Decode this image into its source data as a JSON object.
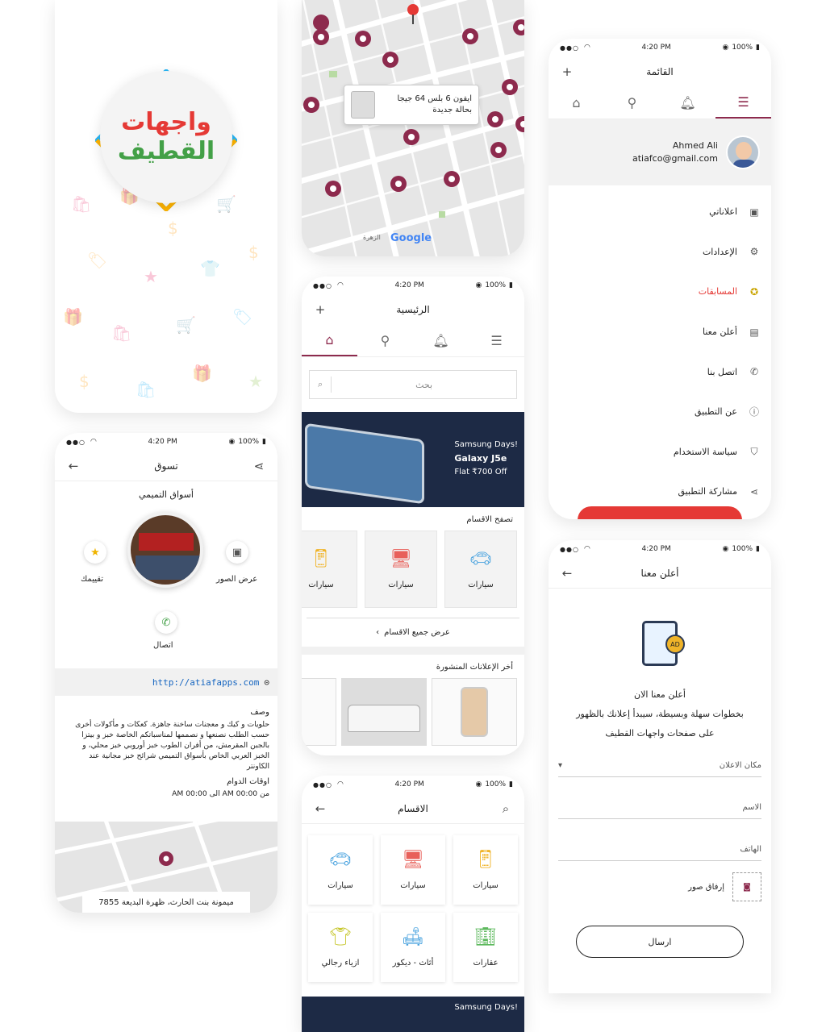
{
  "status": {
    "time": "4:20 PM",
    "battery": "100%"
  },
  "splash": {
    "logo_line1": "واجهات",
    "logo_line2": "القطيف"
  },
  "map_top": {
    "callout_line1": "ايفون 6 بلس 64 جيجا",
    "callout_line2": "بحالة جديدة",
    "google": "Google",
    "area_label": "الزهرة"
  },
  "menu": {
    "title": "القائمة",
    "profile_name": "Ahmed Ali",
    "profile_email": "atiafco@gmail.com",
    "items": [
      {
        "label": "اعلاناتي",
        "icon": "calendar-icon"
      },
      {
        "label": "الإعدادات",
        "icon": "gear-icon"
      },
      {
        "label": "المسابقات",
        "icon": "award-icon"
      },
      {
        "label": "أعلن معنا",
        "icon": "ad-icon"
      },
      {
        "label": "اتصل بنا",
        "icon": "phone-icon"
      },
      {
        "label": "عن التطبيق",
        "icon": "info-icon"
      },
      {
        "label": "سياسة الاستخدام",
        "icon": "shield-icon"
      },
      {
        "label": "مشاركة التطبيق",
        "icon": "share-icon"
      }
    ],
    "accent": "#e53935"
  },
  "home": {
    "title": "الرئيسية",
    "search_placeholder": "بحث",
    "banner_line1": "Samsung Days!",
    "banner_line2": "Galaxy J5e",
    "banner_line3": "Flat ₹700 Off",
    "browse_title": "تصفح الاقسام",
    "categories": [
      "سيارات",
      "سيارات",
      "سيارات"
    ],
    "view_all": "عرض جميع الاقسام",
    "latest_ads_title": "أخر الإعلانات المنشورة"
  },
  "shop": {
    "title": "تسوق",
    "store_name": "أسواق التميمي",
    "rate_label": "تقييمك",
    "gallery_label": "عرض الصور",
    "call_label": "اتصال",
    "link": "http://atiafapps.com",
    "desc_title": "وصف",
    "desc_text": "حلويات و كيك و معجنات ساخنة جاهزة. كعكات و مأكولات أخرى حسب الطلب نصنعها و نصممها لمناسباتكم الخاصة خبز و بيتزا بالجبن المقرمش، من أفران الطوب خبز أوروبي خبز محلي، و الخبز العربي الخاص بأسواق التميمي شرائح خبز مجانية عند الكاونتر",
    "hours_title": "اوقات الدوام",
    "hours_text": "من AM 00:00 الى AM 00:00",
    "address": "ميمونة بنت الحارث، ظهرة البديعة 7855"
  },
  "cats_page": {
    "title": "الاقسام",
    "items": [
      {
        "label": "سيارات",
        "icon": "car-icon",
        "color": "#4aa3df"
      },
      {
        "label": "سيارات",
        "icon": "monitor-icon",
        "color": "#e8605a"
      },
      {
        "label": "سيارات",
        "icon": "phone-icon",
        "color": "#f0b429"
      },
      {
        "label": "ازياء رجالي",
        "icon": "shirt-icon",
        "color": "#c8c832"
      },
      {
        "label": "أثاث - ديكور",
        "icon": "sofa-icon",
        "color": "#4aa3df"
      },
      {
        "label": "عقارات",
        "icon": "building-icon",
        "color": "#5cb85c"
      }
    ],
    "banner_peek": "Samsung Days!"
  },
  "advertise": {
    "title": "أعلن معنا",
    "heading": "أعلن معنا الان",
    "line2": "بخطوات سهلة وبسيطة، سيبدأ إعلانك بالظهور",
    "line3": "على صفحات واجهات القطيف",
    "field_location": "مكان الاعلان",
    "field_name": "الاسم",
    "field_phone": "الهاتف",
    "attach_label": "إرفاق صور",
    "send_label": "ارسال",
    "ad_badge": "AD"
  },
  "colors": {
    "primary": "#8d2a4d",
    "accent": "#e53935",
    "banner": "#1d2a45"
  }
}
